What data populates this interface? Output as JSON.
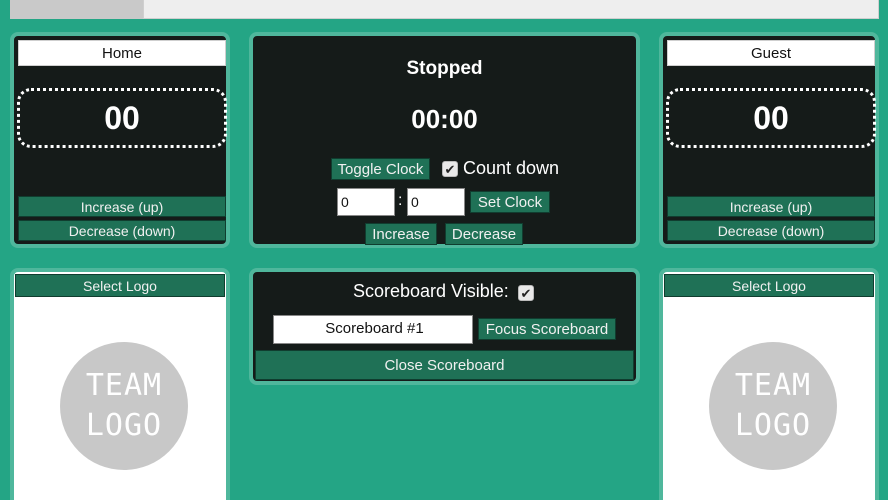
{
  "home": {
    "name": "Home",
    "score": "00",
    "increase_label": "Increase (up)",
    "decrease_label": "Decrease (down)",
    "select_logo_label": "Select Logo",
    "logo_line1": "TEAM",
    "logo_line2": "LOGO"
  },
  "guest": {
    "name": "Guest",
    "score": "00",
    "increase_label": "Increase (up)",
    "decrease_label": "Decrease (down)",
    "select_logo_label": "Select Logo",
    "logo_line1": "TEAM",
    "logo_line2": "LOGO"
  },
  "clock": {
    "status": "Stopped",
    "time": "00:00",
    "toggle_label": "Toggle Clock",
    "count_down_label": "Count down",
    "count_down_checked": true,
    "minutes_value": "0",
    "seconds_value": "0",
    "separator": ":",
    "set_label": "Set Clock",
    "increase_label": "Increase",
    "decrease_label": "Decrease"
  },
  "scoreboard": {
    "visible_label": "Scoreboard Visible:",
    "visible_checked": true,
    "name_value": "Scoreboard #1",
    "focus_label": "Focus Scoreboard",
    "close_label": "Close Scoreboard"
  },
  "colors": {
    "background": "#24a585",
    "panel_dark": "#151b19",
    "button": "#1f7156"
  }
}
